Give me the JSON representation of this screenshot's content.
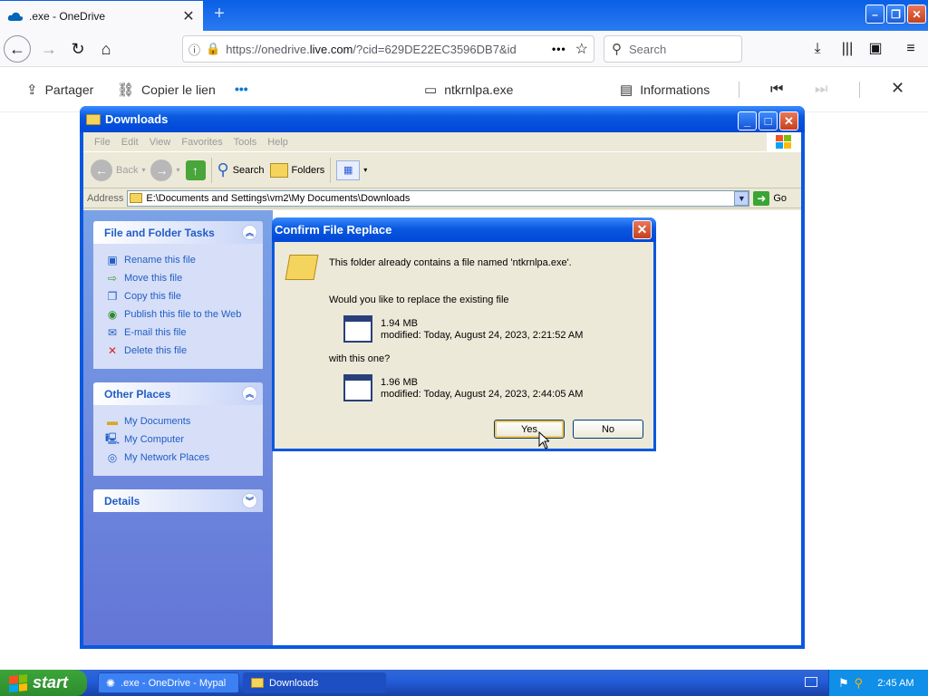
{
  "browser": {
    "tab_title": ".exe - OneDrive",
    "new_tab_symbol": "+",
    "url_host": "https://onedrive.",
    "url_domain": "live.com",
    "url_rest": "/?cid=629DE22EC3596DB7&id",
    "search_placeholder": "Search"
  },
  "onedrive_bar": {
    "share_label": "Partager",
    "copy_link_label": "Copier le lien",
    "more_label": "•••",
    "file_name": "ntkrnlpa.exe",
    "info_label": "Informations"
  },
  "explorer": {
    "title": "Downloads",
    "menu": [
      "File",
      "Edit",
      "View",
      "Favorites",
      "Tools",
      "Help"
    ],
    "toolbar": {
      "back_label": "Back",
      "search_label": "Search",
      "folders_label": "Folders"
    },
    "address_label": "Address",
    "address_value": "E:\\Documents and Settings\\vm2\\My Documents\\Downloads",
    "go_label": "Go",
    "panels": [
      {
        "title": "File and Folder Tasks",
        "items": [
          {
            "label": "Rename this file",
            "icon": "rename-icon"
          },
          {
            "label": "Move this file",
            "icon": "move-icon"
          },
          {
            "label": "Copy this file",
            "icon": "copy-icon"
          },
          {
            "label": "Publish this file to the Web",
            "icon": "globe-icon"
          },
          {
            "label": "E-mail this file",
            "icon": "email-icon"
          },
          {
            "label": "Delete this file",
            "icon": "delete-icon"
          }
        ]
      },
      {
        "title": "Other Places",
        "items": [
          {
            "label": "My Documents",
            "icon": "folder-icon"
          },
          {
            "label": "My Computer",
            "icon": "computer-icon"
          },
          {
            "label": "My Network Places",
            "icon": "network-icon"
          }
        ]
      },
      {
        "title": "Details",
        "items": []
      }
    ]
  },
  "dialog": {
    "title": "Confirm File Replace",
    "message": "This folder already contains a file named 'ntkrnlpa.exe'.",
    "question": "Would you like to replace the existing file",
    "existing_size": "1.94 MB",
    "existing_modified": "modified: Today, August 24, 2023, 2:21:52 AM",
    "with_label": "with this one?",
    "new_size": "1.96 MB",
    "new_modified": "modified: Today, August 24, 2023, 2:44:05 AM",
    "yes_label": "Yes",
    "no_label": "No"
  },
  "taskbar": {
    "start_label": "start",
    "items": [
      {
        "label": ".exe - OneDrive - Mypal",
        "active": false
      },
      {
        "label": "Downloads",
        "active": true
      }
    ],
    "clock": "2:45 AM"
  }
}
